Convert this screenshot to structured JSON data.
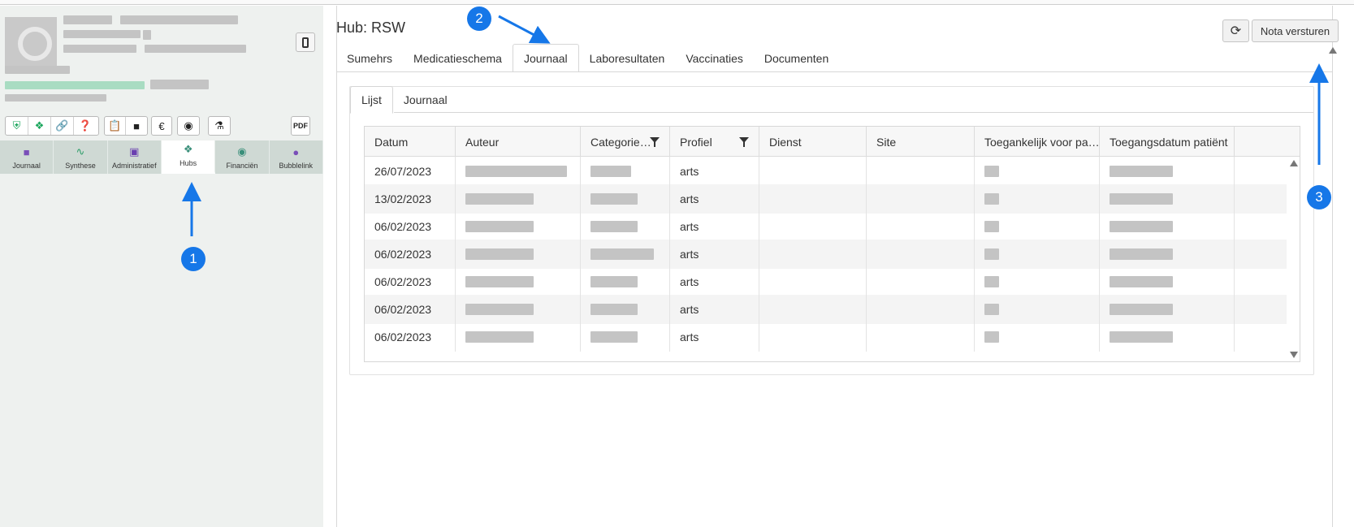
{
  "sidebar": {
    "nav": [
      {
        "label": "Journaal",
        "icon": "folder-icon",
        "color": "#7a4fb8"
      },
      {
        "label": "Synthese",
        "icon": "chart-line-icon",
        "color": "#2f9e6a"
      },
      {
        "label": "Administratief",
        "icon": "person-card-icon",
        "color": "#6a3fb0"
      },
      {
        "label": "Hubs",
        "icon": "hub-network-icon",
        "color": "#3a8f7a",
        "active": true
      },
      {
        "label": "Financiën",
        "icon": "finance-icon",
        "color": "#3a8f7a"
      },
      {
        "label": "Bubblelink",
        "icon": "bubblelink-icon",
        "color": "#7a4fb8"
      }
    ]
  },
  "header": {
    "title": "Hub: RSW",
    "send_button": "Nota versturen"
  },
  "tabs": [
    "Sumehrs",
    "Medicatieschema",
    "Journaal",
    "Laboresultaten",
    "Vaccinaties",
    "Documenten"
  ],
  "active_tab": "Journaal",
  "subtabs": [
    "Lijst",
    "Journaal"
  ],
  "active_subtab": "Lijst",
  "grid": {
    "columns": [
      "Datum",
      "Auteur",
      "Categorie…",
      "Profiel",
      "Dienst",
      "Site",
      "Toegankelijk voor pa…",
      "Toegangsdatum patiënt"
    ],
    "rows": [
      {
        "datum": "26/07/2023",
        "profiel": "arts"
      },
      {
        "datum": "13/02/2023",
        "profiel": "arts"
      },
      {
        "datum": "06/02/2023",
        "profiel": "arts"
      },
      {
        "datum": "06/02/2023",
        "profiel": "arts"
      },
      {
        "datum": "06/02/2023",
        "profiel": "arts"
      },
      {
        "datum": "06/02/2023",
        "profiel": "arts"
      },
      {
        "datum": "06/02/2023",
        "profiel": "arts"
      }
    ]
  },
  "annotations": [
    "1",
    "2",
    "3"
  ],
  "colors": {
    "annotation": "#1677e8",
    "sidebar_bg": "#eef1ef",
    "nav_bg": "#cfd9d4"
  }
}
